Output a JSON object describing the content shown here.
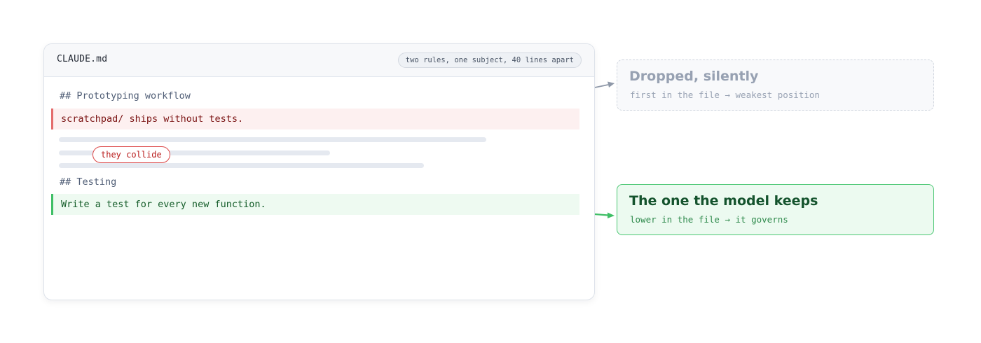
{
  "editor": {
    "filename": "CLAUDE.md",
    "badge": "two rules, one subject, 40 lines apart",
    "sections": [
      {
        "heading": "## Prototyping workflow",
        "rule": "scratchpad/ ships without tests."
      },
      {
        "heading": "## Testing",
        "rule": "Write a test for every new function."
      }
    ],
    "collision_label": "they collide"
  },
  "outcomes": {
    "dropped": {
      "title": "Dropped, silently",
      "subtitle": "first in the file → weakest position"
    },
    "kept": {
      "title": "The one the model keeps",
      "subtitle": "lower in the file → it governs"
    }
  },
  "colors": {
    "dropped_arrow": "#8e98a8",
    "kept_arrow": "#3fbf66",
    "conflict_red": "#dc4646"
  }
}
